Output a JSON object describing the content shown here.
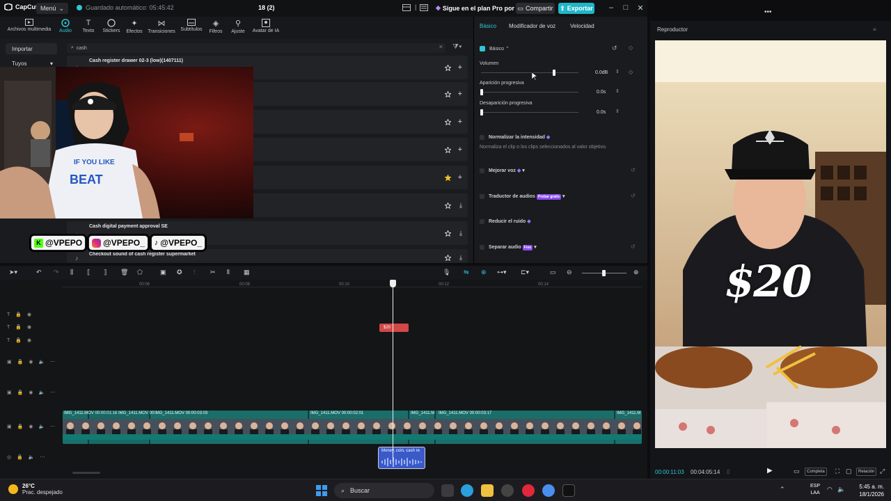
{
  "app": {
    "logo_text": "CapCut",
    "menu_label": "Menú",
    "autosave": "Guardado automático: 05:45:42",
    "project_name": "18 (2)",
    "pro_text": "Sigue en el plan Pro por tai",
    "share_label": "Compartir",
    "export_label": "Exportar"
  },
  "toolbar": {
    "items": [
      {
        "label": "Archivos multimedia",
        "icon": "media-icon"
      },
      {
        "label": "Audio",
        "icon": "audio-icon"
      },
      {
        "label": "Texto",
        "icon": "text-icon"
      },
      {
        "label": "Stickers",
        "icon": "sticker-icon"
      },
      {
        "label": "Efectos",
        "icon": "effects-icon"
      },
      {
        "label": "Transiciones",
        "icon": "transitions-icon"
      },
      {
        "label": "Subtítulos",
        "icon": "subtitles-icon"
      },
      {
        "label": "Filtros",
        "icon": "filters-icon"
      },
      {
        "label": "Ajuste",
        "icon": "adjust-icon"
      },
      {
        "label": "Avatar de IA",
        "icon": "avatar-icon"
      }
    ]
  },
  "media": {
    "import_label": "Importar",
    "yours_label": "Tuyos",
    "search_value": "cash",
    "results": [
      {
        "name": "Cash register drawer 02-3 (low)(1407111)",
        "starred": false,
        "action": "add"
      },
      {
        "name": "",
        "starred": false,
        "action": "add"
      },
      {
        "name": "",
        "starred": false,
        "action": "add"
      },
      {
        "name": "",
        "starred": false,
        "action": "add"
      },
      {
        "name": "",
        "starred": true,
        "action": "add"
      },
      {
        "name": "",
        "starred": false,
        "action": "download"
      },
      {
        "name": "Cash digital payment approval SE",
        "starred": false,
        "action": "download"
      },
      {
        "name": "Checkout sound of cash register supermarket",
        "starred": false,
        "action": "download"
      }
    ]
  },
  "socials": [
    {
      "icon": "kick-icon",
      "handle": "@VPEPO"
    },
    {
      "icon": "instagram-icon",
      "handle": "@VPEPO_"
    },
    {
      "icon": "tiktok-icon",
      "handle": "@VPEPO_"
    }
  ],
  "props": {
    "tabs": [
      "Básico",
      "Modificador de voz",
      "Velocidad"
    ],
    "section_label": "Básico",
    "volume_label": "Volumen",
    "volume_value": "0.0dB",
    "volume_level": 0.75,
    "fadein_label": "Aparición progresiva",
    "fadein_value": "0.0s",
    "fadeout_label": "Desaparición progresiva",
    "fadeout_value": "0.0s",
    "normalize_label": "Normalizar la intensidad",
    "normalize_desc": "Normaliza el clip o los clips seleccionados al valor objetivo.",
    "enhance_label": "Mejorar voz",
    "translator_label": "Traductor de audios",
    "translator_badge": "Probar gratis",
    "noise_label": "Reducir el ruido",
    "separate_label": "Separar audio",
    "separate_badge": "Free"
  },
  "player": {
    "title": "Reproductor",
    "overlay_text": "$20",
    "time_current": "00:00:11:03",
    "time_total": "00:04:05:14",
    "btn_full": "Completa",
    "btn_ratio": "Relación"
  },
  "timeline": {
    "ruler": [
      "00:06",
      "00:08",
      "00:10",
      "00:12",
      "00:14"
    ],
    "text_clip": "$20",
    "video_clips": [
      "IMG_1411.MOV  00:00:01:16",
      "IMG_1411.MOV  00",
      "IMG_1411.MOV  00:00:03:03",
      "IMG_1411.MOV  00:00:02:01",
      "IMG_1411.M",
      "IMG_1411.MOV  00:00:03:17",
      "IMG_1411.M"
    ],
    "audio_clip": "Money, coin, cash re"
  },
  "taskbar": {
    "temp": "26°C",
    "weather": "Prac. despejado",
    "search_label": "Buscar",
    "lang_top": "ESP",
    "lang_bottom": "LAA",
    "time": "5:45 a. m.",
    "date": "18/1/2026"
  },
  "colors": {
    "accent": "#2ec6d6",
    "export": "#1fb7c8",
    "clip_video": "#1a6e6a",
    "clip_text": "#d24848",
    "clip_audio": "#3a5ac8"
  }
}
